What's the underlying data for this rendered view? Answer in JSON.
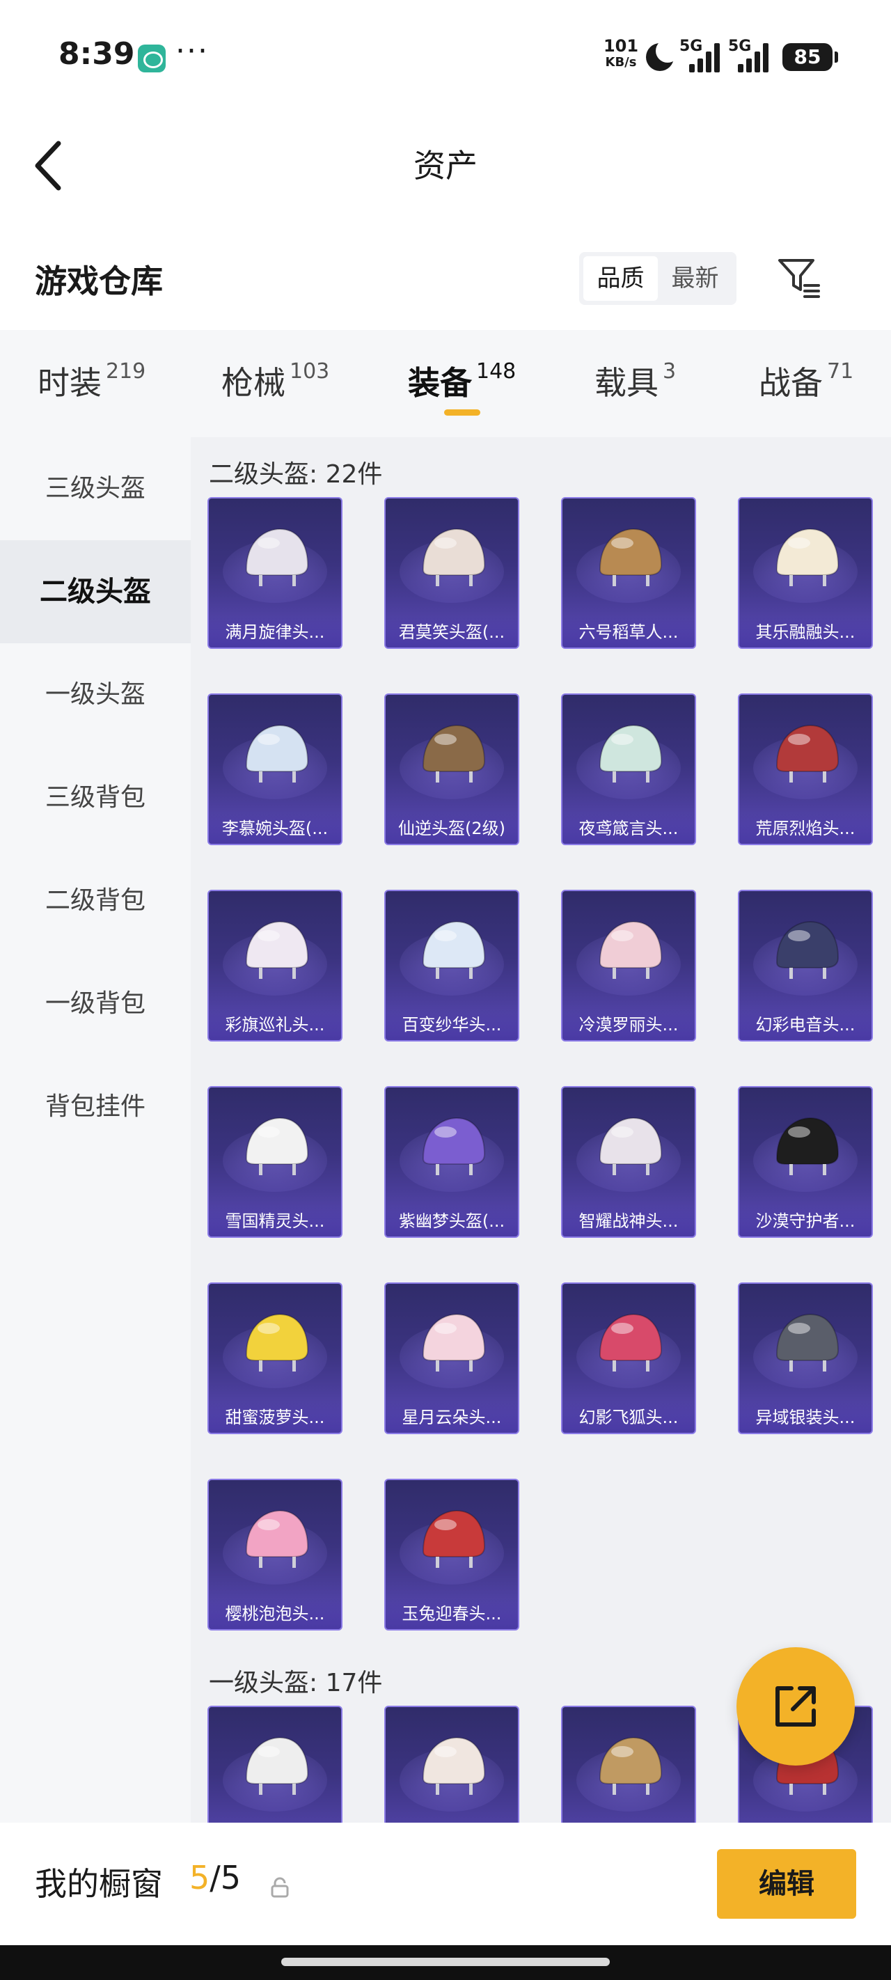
{
  "status_bar": {
    "time": "8:39",
    "dots": "···",
    "net_speed": "101",
    "net_unit": "KB/s",
    "sim1": "5G",
    "sim2": "5G",
    "battery": "85",
    "icons": [
      "wechat-icon",
      "moon-icon",
      "signal-icon",
      "battery-icon"
    ]
  },
  "header": {
    "title": "资产",
    "back_icon": "back-arrow-icon"
  },
  "warehouse": {
    "title": "游戏仓库",
    "sort_options": [
      "品质",
      "最新"
    ],
    "sort_selected": "品质",
    "filter_icon": "filter-icon"
  },
  "tabs": [
    {
      "label": "时装",
      "count": "219"
    },
    {
      "label": "枪械",
      "count": "103"
    },
    {
      "label": "装备",
      "count": "148"
    },
    {
      "label": "载具",
      "count": "3"
    },
    {
      "label": "战备",
      "count": "71"
    }
  ],
  "active_tab": "装备",
  "sidebar": {
    "items": [
      "三级头盔",
      "二级头盔",
      "一级头盔",
      "三级背包",
      "二级背包",
      "一级背包",
      "背包挂件"
    ],
    "active": "二级头盔"
  },
  "sections": [
    {
      "title": "二级头盔: 22件",
      "items": [
        {
          "name": "满月旋律头...",
          "color": "#e6e2ec"
        },
        {
          "name": "君莫笑头盔(...",
          "color": "#e9ddd6"
        },
        {
          "name": "六号稻草人...",
          "color": "#b88a52"
        },
        {
          "name": "其乐融融头...",
          "color": "#f3ead6"
        },
        {
          "name": "李慕婉头盔(...",
          "color": "#d5e2f2"
        },
        {
          "name": "仙逆头盔(2级)",
          "color": "#8a6a48"
        },
        {
          "name": "夜鸢箴言头...",
          "color": "#cfe6de"
        },
        {
          "name": "荒原烈焰头...",
          "color": "#b23a3a"
        },
        {
          "name": "彩旗巡礼头...",
          "color": "#efe8f2"
        },
        {
          "name": "百变纱华头...",
          "color": "#dde8f6"
        },
        {
          "name": "冷漠罗丽头...",
          "color": "#f0cdd6"
        },
        {
          "name": "幻彩电音头...",
          "color": "#3a3f6a"
        },
        {
          "name": "雪国精灵头...",
          "color": "#f2f2f2"
        },
        {
          "name": "紫幽梦头盔(...",
          "color": "#7b5ed0"
        },
        {
          "name": "智耀战神头...",
          "color": "#e8e2ea"
        },
        {
          "name": "沙漠守护者...",
          "color": "#1e1e1e"
        },
        {
          "name": "甜蜜菠萝头...",
          "color": "#f2d23c"
        },
        {
          "name": "星月云朵头...",
          "color": "#f4d4de"
        },
        {
          "name": "幻影飞狐头...",
          "color": "#d84a6a"
        },
        {
          "name": "异域银装头...",
          "color": "#5a5e6a"
        },
        {
          "name": "樱桃泡泡头...",
          "color": "#f2a4c4"
        },
        {
          "name": "玉兔迎春头...",
          "color": "#c83a3a"
        }
      ]
    },
    {
      "title": "一级头盔: 17件",
      "items": [
        {
          "name": "",
          "color": "#eeeeee"
        },
        {
          "name": "",
          "color": "#f0e6e0"
        },
        {
          "name": "",
          "color": "#c09a62"
        },
        {
          "name": "",
          "color": "#b83232"
        }
      ]
    }
  ],
  "fab_icon": "share-icon",
  "bottom": {
    "label": "我的橱窗",
    "current": "5",
    "separator": "/",
    "total": "5",
    "lock_icon": "lock-icon",
    "edit_label": "编辑"
  }
}
